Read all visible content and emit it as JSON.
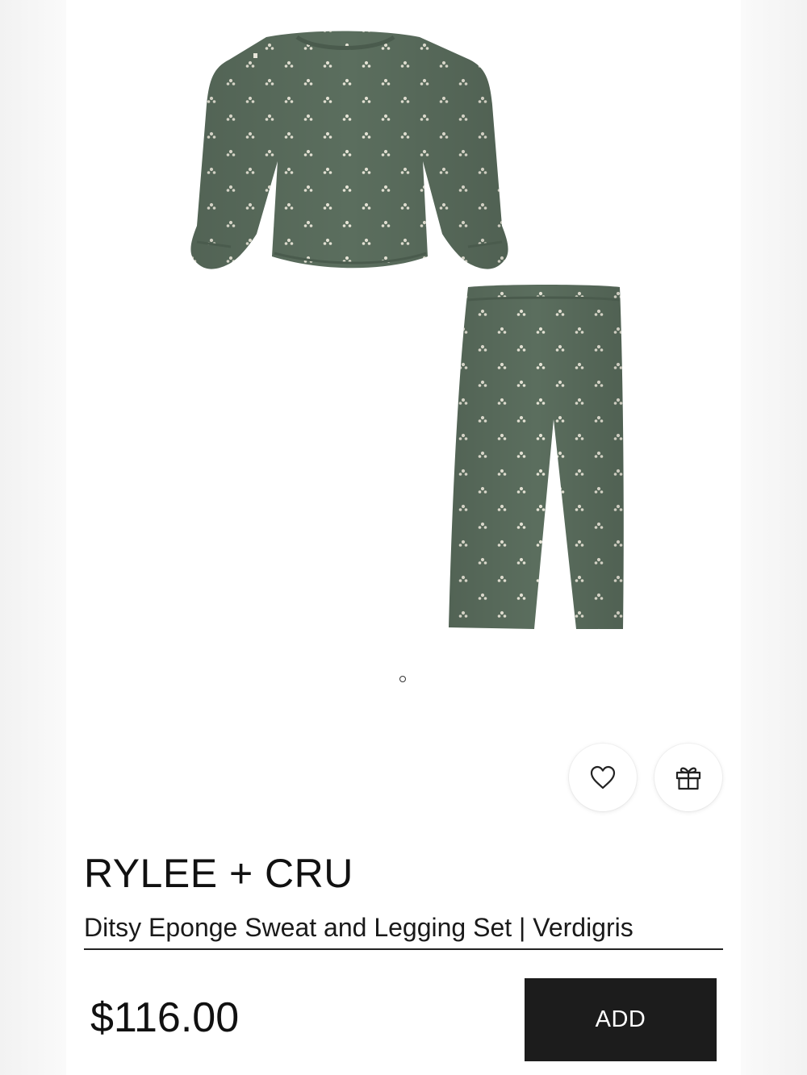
{
  "product": {
    "brand": "RYLEE + CRU",
    "name": "Ditsy Eponge Sweat and Legging Set | Verdigris",
    "price": "$116.00",
    "image_alt": "Ditsy Eponge Sweat and Legging Set | Verdigris"
  },
  "carousel": {
    "dot_count": 1,
    "active_index": 0
  },
  "actions": {
    "add_label": "ADD",
    "wishlist_icon": "heart-icon",
    "gift_icon": "gift-icon"
  },
  "colors": {
    "garment": "#5a6d5d",
    "garment_shadow": "#4c5e50",
    "print_dot": "#e6e4d6",
    "add_button_bg": "#1c1c1c",
    "text": "#111111"
  }
}
